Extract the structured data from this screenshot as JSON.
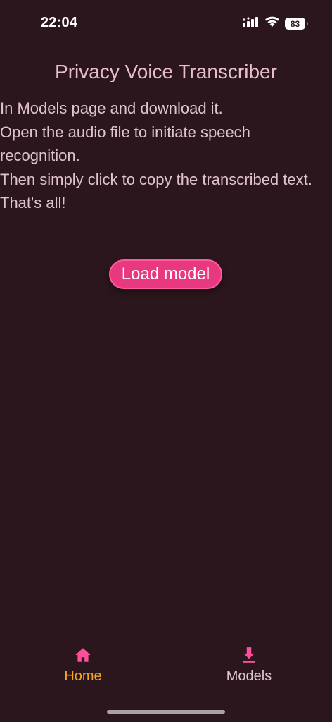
{
  "status_bar": {
    "time": "22:04",
    "battery_level": "83",
    "icons": [
      "cellular-signal-icon",
      "wifi-icon",
      "battery-icon"
    ]
  },
  "title": "Privacy Voice Transcriber",
  "instructions": [
    "In Models page and download it.",
    "Open the audio file to initiate speech recognition.",
    "Then simply click to copy the transcribed text.",
    "That's all!"
  ],
  "load_button": {
    "label": "Load model"
  },
  "bottom_nav": {
    "items": [
      {
        "label": "Home",
        "icon": "home-icon",
        "active": true
      },
      {
        "label": "Models",
        "icon": "download-icon",
        "active": false
      }
    ]
  },
  "colors": {
    "background": "#2c161d",
    "accent": "#e8387f",
    "active_nav_label": "#f5a623",
    "text": "#e0c4cc"
  }
}
